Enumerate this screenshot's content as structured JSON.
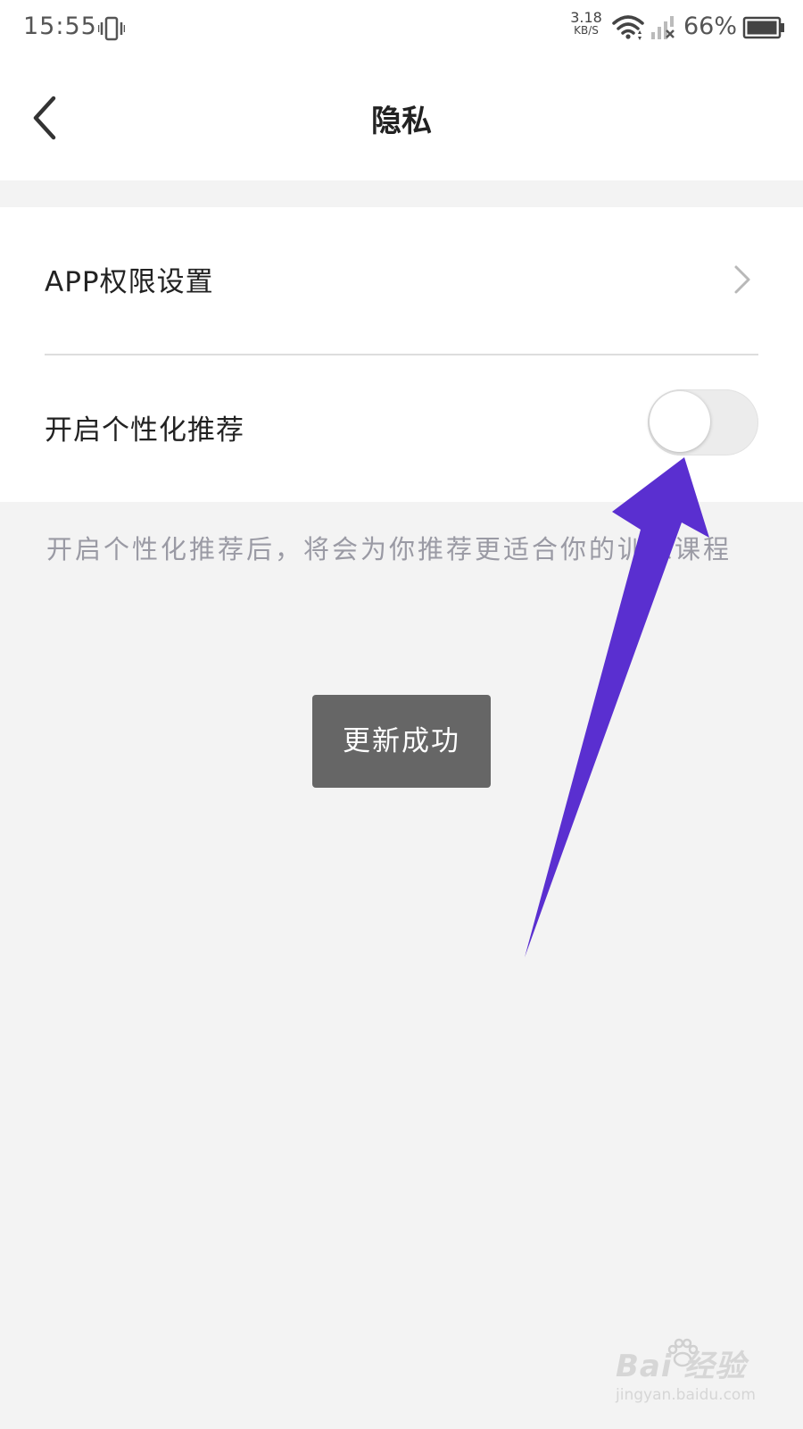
{
  "status_bar": {
    "time": "15:55",
    "net_speed_value": "3.18",
    "net_speed_unit": "KB/S",
    "battery": "66%",
    "icons": [
      "vibrate-icon",
      "wifi-icon",
      "signal-icon",
      "battery-icon"
    ]
  },
  "nav": {
    "title": "隐私",
    "back_icon": "chevron-left-icon"
  },
  "settings": {
    "permissions_label": "APP权限设置",
    "personalized_label": "开启个性化推荐",
    "personalized_enabled": false
  },
  "description": "开启个性化推荐后，将会为你推荐更适合你的训练课程",
  "toast": "更新成功",
  "annotation": {
    "arrow_color": "#5a2fd0"
  },
  "watermark": {
    "brand": "Bai  经验",
    "sub": "jingyan.baidu.com"
  },
  "colors": {
    "background": "#f3f3f3",
    "toast_bg": "#666666",
    "description_text": "#9a9aa4"
  }
}
